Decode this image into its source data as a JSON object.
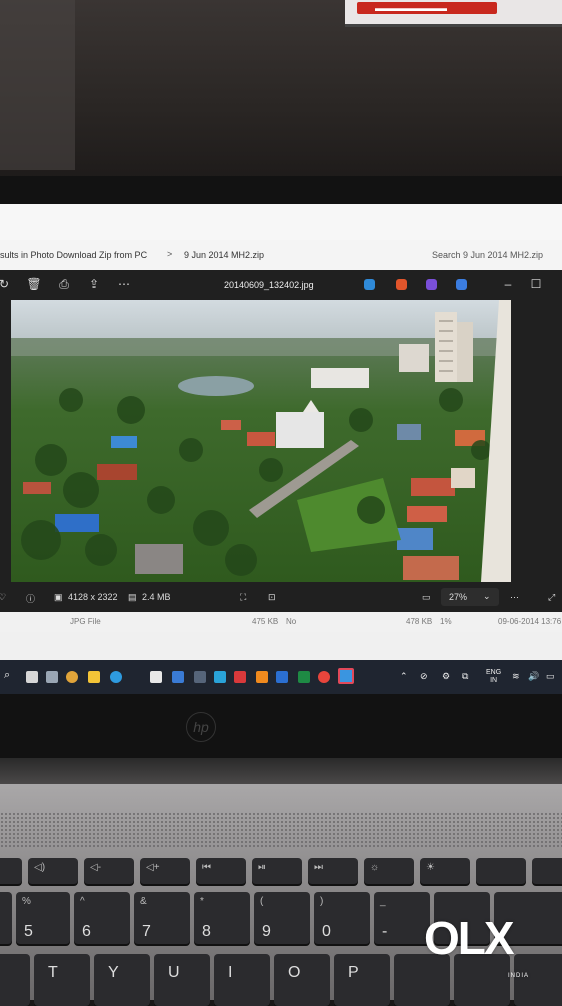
{
  "explorer": {
    "breadcrumb": "sults in Photo Download Zip from PC",
    "breadcrumb_separator": ">",
    "current_folder": "9 Jun 2014 MH2.zip",
    "search_placeholder": "Search 9 Jun 2014 MH2.zip"
  },
  "photos_app": {
    "filename": "20140609_132402.jpg",
    "dimensions": "4128 x 2322",
    "file_size": "2.4 MB",
    "zoom": "27%"
  },
  "file_row": {
    "type": "JPG File",
    "size": "475 KB",
    "protected": "No",
    "compressed": "478 KB",
    "ratio": "1%",
    "date": "09-06-2014 13:76"
  },
  "taskbar": {
    "lang_line1": "ENG",
    "lang_line2": "IN"
  },
  "keyboard": {
    "row_numbers": [
      {
        "top": "%",
        "bottom": "5"
      },
      {
        "top": "^",
        "bottom": "6"
      },
      {
        "top": "&",
        "bottom": "7"
      },
      {
        "top": "*",
        "bottom": "8"
      },
      {
        "top": "(",
        "bottom": "9"
      },
      {
        "top": ")",
        "bottom": "0"
      },
      {
        "top": "_",
        "bottom": "-"
      }
    ],
    "row_letters": [
      "T",
      "Y",
      "U",
      "I",
      "O",
      "P"
    ]
  },
  "watermark": {
    "brand": "OLX",
    "tag": "INDIA"
  },
  "colors": {
    "viewer_bg": "#202020",
    "taskbar_bg": "#1f2530",
    "sky": "#c9d2d8",
    "foliage": "#3f6b2a"
  }
}
